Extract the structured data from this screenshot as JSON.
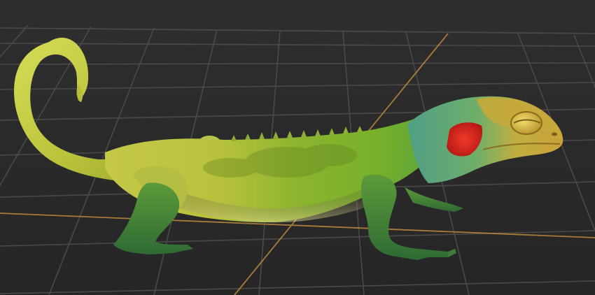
{
  "viewport": {
    "kind": "3d-perspective-viewport",
    "background_color": "#2b2b2b",
    "grid": {
      "visible": true,
      "line_color": "#4a4a4a",
      "axis_color": "#c08a3e"
    }
  },
  "model": {
    "subject": "lizard",
    "parts": [
      "tail",
      "body",
      "head",
      "eye",
      "ear-patch",
      "front-leg",
      "back-leg",
      "dorsal-spines"
    ],
    "colors": {
      "body_yellow": "#c9cf48",
      "body_green": "#6aa42b",
      "head_teal": "#4fa58a",
      "head_gold": "#c7b03d",
      "legs_green": "#3b7a3a",
      "ear_red": "#d4231d"
    }
  }
}
